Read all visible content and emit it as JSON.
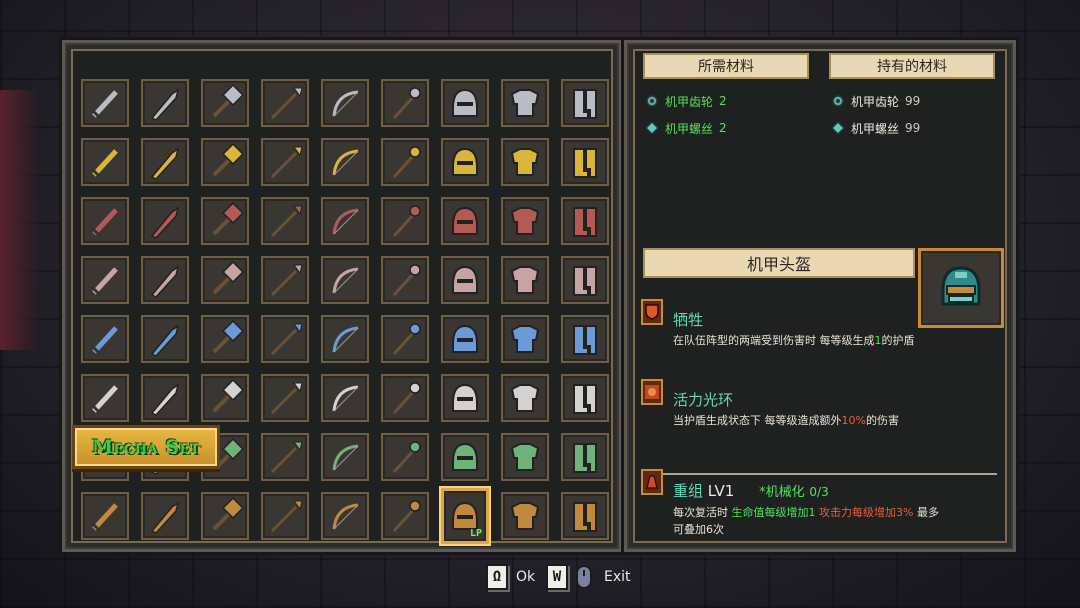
{
  "materials": {
    "required_header": "所需材料",
    "owned_header": "持有的材料",
    "required": [
      {
        "name": "机甲齿轮",
        "count": "2",
        "icon": "gear-icon"
      },
      {
        "name": "机甲螺丝",
        "count": "2",
        "icon": "screw-icon"
      }
    ],
    "owned": [
      {
        "name": "机甲齿轮",
        "count": "99",
        "icon": "gear-icon"
      },
      {
        "name": "机甲螺丝",
        "count": "99",
        "icon": "screw-icon"
      }
    ]
  },
  "item": {
    "title": "机甲头盔",
    "icon": "mecha-helmet-icon"
  },
  "skills": {
    "sacrifice": {
      "name": "牺牲",
      "desc_a": "在队伍阵型的两端受到伤害时 每等级生成",
      "desc_b": "1",
      "desc_c": "的护盾"
    },
    "aura": {
      "name": "活力光环",
      "desc_a": "当护盾生成状态下 每等级造成额外",
      "desc_b": "10%",
      "desc_c": "的伤害"
    },
    "reassemble": {
      "name": "重组",
      "level": "LV1",
      "tag": "*机械化",
      "progress": "0/3",
      "desc_a": "每次复活时",
      "desc_b": "生命值每级增加1",
      "desc_c": "攻击力每级增加3%",
      "desc_d": "最多",
      "desc_e": "可叠加6次"
    }
  },
  "set_banner": "Mecha Set",
  "selected_slot_tag": "LP",
  "grid": {
    "item_types": [
      "sword",
      "broadsword",
      "hammer",
      "spear",
      "bow",
      "staff",
      "helmet",
      "armor",
      "boots"
    ],
    "tiers": [
      {
        "name": "steel",
        "color": "#b9bcc4"
      },
      {
        "name": "gold",
        "color": "#d9b53a"
      },
      {
        "name": "crimson",
        "color": "#b35a55"
      },
      {
        "name": "rose",
        "color": "#c7a4a2"
      },
      {
        "name": "azure",
        "color": "#6b9ad8"
      },
      {
        "name": "silver",
        "color": "#d4d2cf"
      },
      {
        "name": "jade",
        "color": "#6fb27a"
      },
      {
        "name": "mecha",
        "color": "#c08a3e"
      }
    ],
    "selected": {
      "row": 7,
      "col": 6
    }
  },
  "prompts": {
    "ok_key": "Ω",
    "ok_label": "Ok",
    "exit_key": "W",
    "exit_label": "Exit"
  },
  "colors": {
    "accent_gold": "#d7a94a",
    "skill_name": "#63d8b6",
    "highlight_green": "#4ee358",
    "highlight_red": "#ef5a3c"
  }
}
